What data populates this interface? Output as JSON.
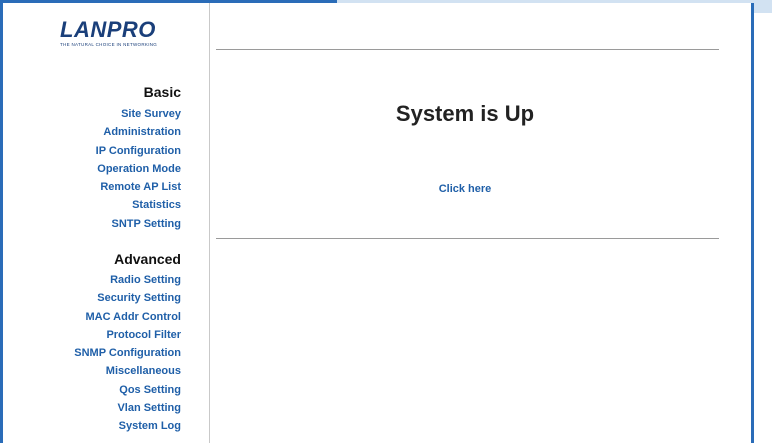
{
  "logo": {
    "brand": "LANPRO",
    "tagline": "THE NATURAL CHOICE IN NETWORKING"
  },
  "sidebar": {
    "basic_title": "Basic",
    "basic_items": [
      "Site Survey",
      "Administration",
      "IP Configuration",
      "Operation Mode",
      "Remote AP List",
      "Statistics",
      "SNTP Setting"
    ],
    "advanced_title": "Advanced",
    "advanced_items": [
      "Radio Setting",
      "Security Setting",
      "MAC Addr Control",
      "Protocol Filter",
      "SNMP Configuration",
      "Miscellaneous",
      "Qos Setting",
      "Vlan Setting",
      "System Log"
    ]
  },
  "main": {
    "title": "System is Up",
    "link_label": "Click here"
  },
  "colors": {
    "frame": "#2a6cb8",
    "accent_bar": "#d2e2f2",
    "link": "#1f5fa8",
    "logo": "#1a3f7a"
  }
}
